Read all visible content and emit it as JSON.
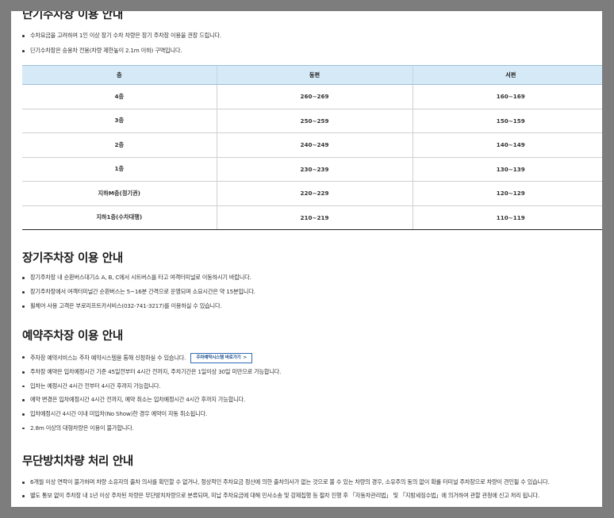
{
  "short_term": {
    "title": "단기주차장 이용 안내",
    "bullets": [
      "수차요금을 고려하여 1인 이상 장기 수차 차량은 장기 주차장 이용을 권장 드립니다.",
      "단기수차장은 승용차 전용(차량 제한높이 2.1m 이하) 구역입니다."
    ],
    "table": {
      "headers": [
        "층",
        "동편",
        "서편"
      ],
      "rows": [
        [
          "4층",
          "260~269",
          "160~169"
        ],
        [
          "3층",
          "250~259",
          "150~159"
        ],
        [
          "2층",
          "240~249",
          "140~149"
        ],
        [
          "1층",
          "230~239",
          "130~139"
        ],
        [
          "지하M층(정기권)",
          "220~229",
          "120~129"
        ],
        [
          "지하1층(수차대행)",
          "210~219",
          "110~119"
        ]
      ]
    }
  },
  "long_term": {
    "title": "장기주차장 이용 안내",
    "bullets": [
      "장기주차장 내 순환버스대기소 A, B, C에서 시트버스를 타고 여객터미널로 이동하시기 바랍니다.",
      "장기주차장에서 여객터미널간 순환버스는 5~16분 간격으로 운영되며 소요시간은 약 15분입니다.",
      "휠체어 사용 고객은 부로리프트카서비스(032-741-3217)를 이용하실 수 있습니다."
    ]
  },
  "reservation": {
    "title": "예약주차장 이용 안내",
    "bullets": [
      "주차장 예약서비스는 주차 예약시스템을 통해 신청하실 수 있습니다.",
      "주차장 예약은 입차예정시간 기준 45일전부터 4시간 전까지, 주차기간은 1일이상 30일 미만으로 가능합니다.",
      "입차는 예정시간 4시간 전부터 4시간 후까지 가능합니다.",
      "예약 변경은 입차예정시간 4시간 전까지, 예약 취소는 입차예정시간 4시간 후까지 가능합니다.",
      "입차예정시간 4시간 이내 미입차(No Show)한 경우 예약이 자동 취소됩니다.",
      "2.8m 이상의 대형차량은 이용이 불가합니다."
    ],
    "button_label": "주차예약시스템 바로가기",
    "button_chevron": ">"
  },
  "abandoned": {
    "title": "무단방치차량 처리 안내",
    "bullets": [
      "6개월 이상 연락이 불가하며 차량 소유자의 출차 의사를 확인할 수 없거나, 정상적인 주차요금 정산에 의한 출차의사가 없는 것으로 볼 수 있는 차량의 경우, 소유주의 동의 없이 확률 터미널 주차장으로 차량이 견인될 수 있습니다.",
      "별도 통보 없이 주차장 내 1년 이상 주차된 차량은 무단방치차량으로 분류되며, 미납 주차요금에 대해 민사소송 및 강제집행 등 절차 진행 후 「자동차관리법」 및 「지방세징수법」에 의거하여 관할 관청에 신고 처리 됩니다."
    ]
  }
}
